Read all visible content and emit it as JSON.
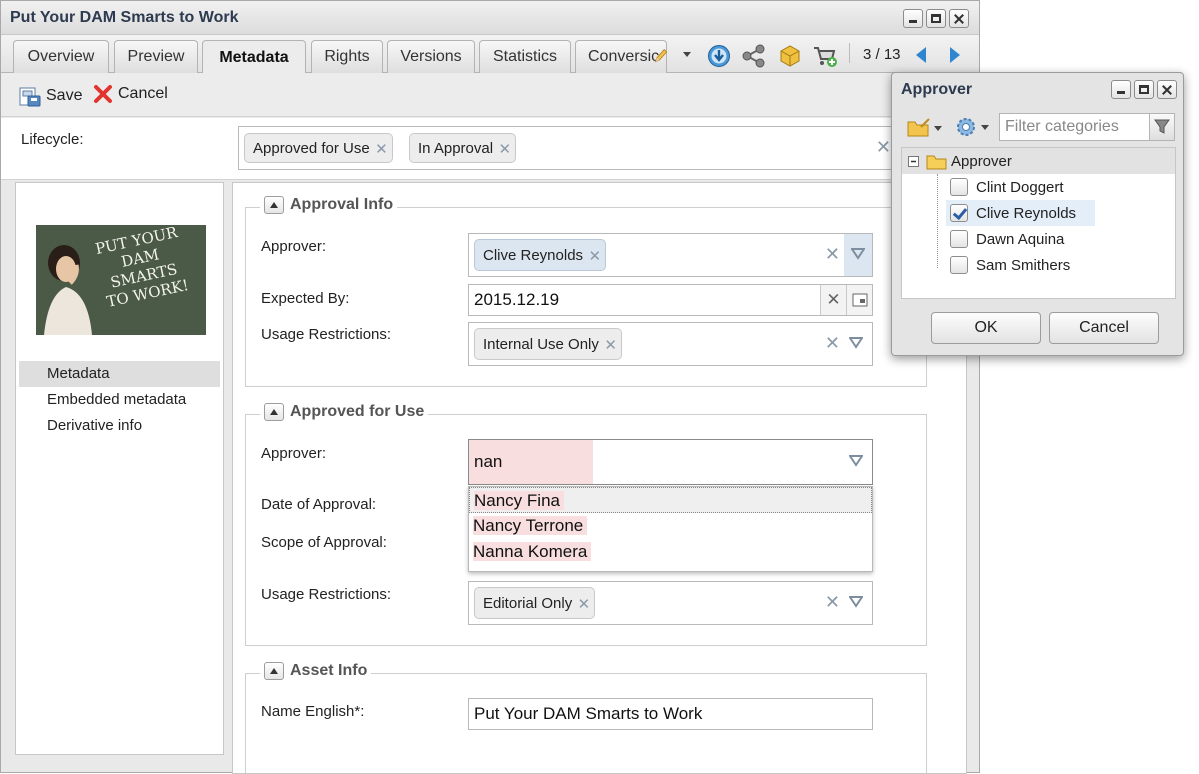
{
  "window": {
    "title": "Put Your DAM Smarts to Work"
  },
  "tabs": [
    {
      "label": "Overview"
    },
    {
      "label": "Preview"
    },
    {
      "label": "Metadata",
      "active": true
    },
    {
      "label": "Rights"
    },
    {
      "label": "Versions"
    },
    {
      "label": "Statistics"
    },
    {
      "label": "Conversic"
    }
  ],
  "pager": {
    "text": "3 / 13"
  },
  "toolbar": {
    "save_label": "Save",
    "cancel_label": "Cancel"
  },
  "lifecycle": {
    "label": "Lifecycle:",
    "tags": [
      "Approved for Use",
      "In Approval"
    ]
  },
  "thumbnail": {
    "lines": [
      "PUT YOUR",
      "DAM",
      "SMARTS",
      "TO WORK!"
    ]
  },
  "nav": {
    "items": [
      "Metadata",
      "Embedded metadata",
      "Derivative info"
    ]
  },
  "approval_info": {
    "legend": "Approval Info",
    "approver_label": "Approver:",
    "approver_tag": "Clive Reynolds",
    "expected_label": "Expected By:",
    "expected_value": "2015.12.19",
    "usage_label": "Usage Restrictions:",
    "usage_tag": "Internal Use Only"
  },
  "approved_for_use": {
    "legend": "Approved for Use",
    "approver_label": "Approver:",
    "approver_value": "nan",
    "date_label": "Date of Approval:",
    "scope_label": "Scope of Approval:",
    "usage_label": "Usage Restrictions:",
    "usage_tag": "Editorial Only",
    "suggestions": [
      "Nancy Fina",
      "Nancy Terrone",
      "Nanna Komera"
    ]
  },
  "asset_info": {
    "legend": "Asset Info",
    "name_label": "Name English*:",
    "name_value": "Put Your DAM Smarts to Work"
  },
  "approver_dialog": {
    "title": "Approver",
    "filter_placeholder": "Filter categories",
    "root": "Approver",
    "items": [
      {
        "name": "Clint Doggert",
        "checked": false
      },
      {
        "name": "Clive Reynolds",
        "checked": true
      },
      {
        "name": "Dawn Aquina",
        "checked": false
      },
      {
        "name": "Sam Smithers",
        "checked": false
      }
    ],
    "ok_label": "OK",
    "cancel_label": "Cancel"
  },
  "colors": {
    "title_text": "#2d3a4f",
    "accent_blue": "#2f86d0",
    "highlight": "#f8dede",
    "selected_row": "#e4eef8"
  }
}
